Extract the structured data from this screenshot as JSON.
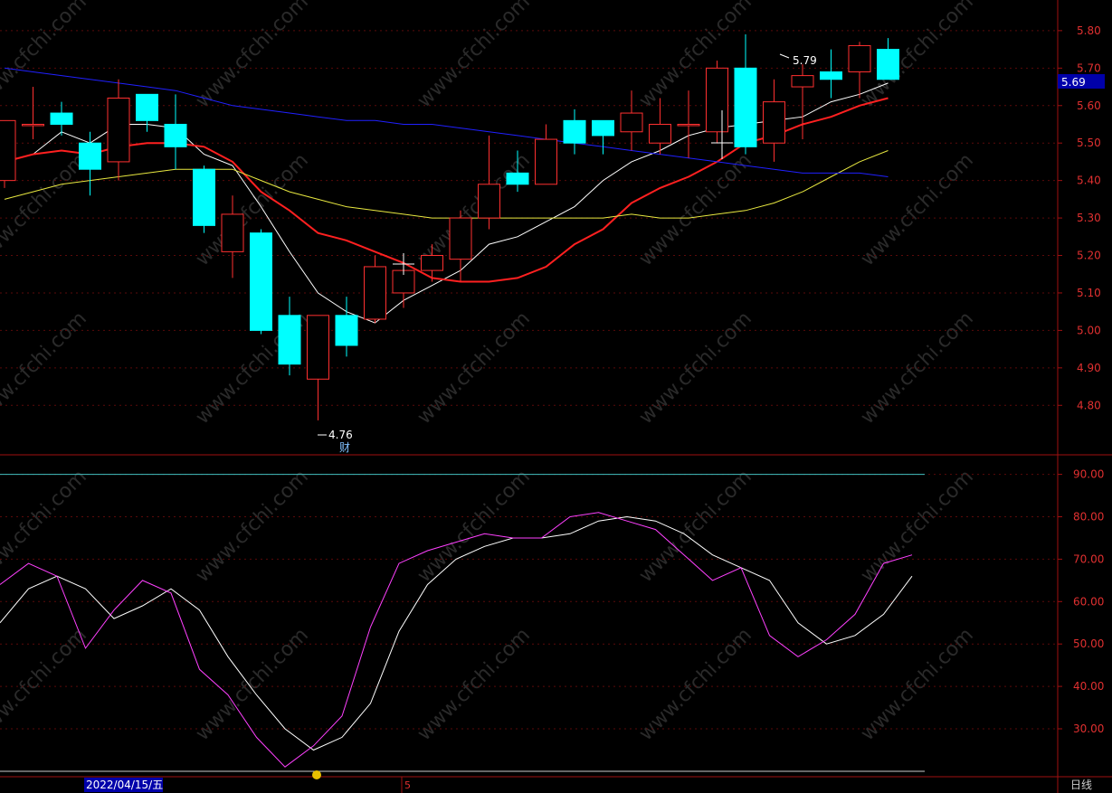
{
  "chart_data": [
    {
      "type": "candlestick",
      "period_label": "日线",
      "date_label": "2022/04/15/五",
      "axis_marker": "5",
      "ylim": [
        4.7,
        5.9
      ],
      "yticks": [
        "5.80",
        "5.70",
        "5.60",
        "5.50",
        "5.40",
        "5.30",
        "5.20",
        "5.10",
        "5.00",
        "4.90",
        "4.80"
      ],
      "current_price": "5.69",
      "high_label": "5.79",
      "low_label": "4.76",
      "event_marker": "财",
      "watermark": "www.cfchi.com",
      "colors": {
        "up": "#ff3030",
        "down": "#00ffff",
        "ma5": "#ffffff",
        "ma10": "#ff2020",
        "ma20": "#e8e840",
        "ma60": "#2020ff",
        "price_tag_bg": "#0000aa"
      },
      "candles": [
        {
          "o": 5.4,
          "h": 5.56,
          "l": 5.38,
          "c": 5.56
        },
        {
          "o": 5.55,
          "h": 5.65,
          "l": 5.51,
          "c": 5.55
        },
        {
          "o": 5.58,
          "h": 5.61,
          "l": 5.52,
          "c": 5.55
        },
        {
          "o": 5.5,
          "h": 5.53,
          "l": 5.36,
          "c": 5.43
        },
        {
          "o": 5.45,
          "h": 5.67,
          "l": 5.4,
          "c": 5.62
        },
        {
          "o": 5.63,
          "h": 5.63,
          "l": 5.53,
          "c": 5.56
        },
        {
          "o": 5.55,
          "h": 5.63,
          "l": 5.43,
          "c": 5.49
        },
        {
          "o": 5.43,
          "h": 5.44,
          "l": 5.26,
          "c": 5.28
        },
        {
          "o": 5.21,
          "h": 5.36,
          "l": 5.14,
          "c": 5.31
        },
        {
          "o": 5.26,
          "h": 5.27,
          "l": 4.99,
          "c": 5.0
        },
        {
          "o": 5.04,
          "h": 5.09,
          "l": 4.88,
          "c": 4.91
        },
        {
          "o": 4.87,
          "h": 5.04,
          "l": 4.76,
          "c": 5.04
        },
        {
          "o": 5.04,
          "h": 5.09,
          "l": 4.93,
          "c": 4.96
        },
        {
          "o": 5.03,
          "h": 5.2,
          "l": 5.02,
          "c": 5.17
        },
        {
          "o": 5.1,
          "h": 5.19,
          "l": 5.06,
          "c": 5.16
        },
        {
          "o": 5.16,
          "h": 5.23,
          "l": 5.13,
          "c": 5.2
        },
        {
          "o": 5.19,
          "h": 5.32,
          "l": 5.13,
          "c": 5.3
        },
        {
          "o": 5.3,
          "h": 5.52,
          "l": 5.27,
          "c": 5.39
        },
        {
          "o": 5.42,
          "h": 5.48,
          "l": 5.37,
          "c": 5.39
        },
        {
          "o": 5.39,
          "h": 5.55,
          "l": 5.39,
          "c": 5.51
        },
        {
          "o": 5.56,
          "h": 5.59,
          "l": 5.47,
          "c": 5.5
        },
        {
          "o": 5.56,
          "h": 5.56,
          "l": 5.47,
          "c": 5.52
        },
        {
          "o": 5.53,
          "h": 5.64,
          "l": 5.48,
          "c": 5.58
        },
        {
          "o": 5.5,
          "h": 5.62,
          "l": 5.47,
          "c": 5.55
        },
        {
          "o": 5.55,
          "h": 5.64,
          "l": 5.46,
          "c": 5.55
        },
        {
          "o": 5.53,
          "h": 5.72,
          "l": 5.5,
          "c": 5.7
        },
        {
          "o": 5.7,
          "h": 5.79,
          "l": 5.47,
          "c": 5.49
        },
        {
          "o": 5.5,
          "h": 5.67,
          "l": 5.45,
          "c": 5.61
        },
        {
          "o": 5.65,
          "h": 5.71,
          "l": 5.51,
          "c": 5.68
        },
        {
          "o": 5.69,
          "h": 5.75,
          "l": 5.62,
          "c": 5.67
        },
        {
          "o": 5.69,
          "h": 5.77,
          "l": 5.62,
          "c": 5.76
        },
        {
          "o": 5.75,
          "h": 5.78,
          "l": 5.67,
          "c": 5.67
        }
      ],
      "ma_series": [
        {
          "key": "ma5",
          "values": [
            5.45,
            5.47,
            5.53,
            5.5,
            5.55,
            5.55,
            5.54,
            5.47,
            5.44,
            5.33,
            5.21,
            5.1,
            5.05,
            5.02,
            5.08,
            5.12,
            5.16,
            5.23,
            5.25,
            5.29,
            5.33,
            5.4,
            5.45,
            5.48,
            5.52,
            5.54,
            5.55,
            5.56,
            5.57,
            5.61,
            5.63,
            5.66
          ]
        },
        {
          "key": "ma10",
          "values": [
            5.45,
            5.47,
            5.48,
            5.47,
            5.49,
            5.5,
            5.5,
            5.49,
            5.45,
            5.37,
            5.32,
            5.26,
            5.24,
            5.21,
            5.18,
            5.14,
            5.13,
            5.13,
            5.14,
            5.17,
            5.23,
            5.27,
            5.34,
            5.38,
            5.41,
            5.45,
            5.5,
            5.52,
            5.55,
            5.57,
            5.6,
            5.62
          ]
        },
        {
          "key": "ma20",
          "values": [
            5.35,
            5.37,
            5.39,
            5.4,
            5.41,
            5.42,
            5.43,
            5.43,
            5.43,
            5.4,
            5.37,
            5.35,
            5.33,
            5.32,
            5.31,
            5.3,
            5.3,
            5.3,
            5.3,
            5.3,
            5.3,
            5.3,
            5.31,
            5.3,
            5.3,
            5.31,
            5.32,
            5.34,
            5.37,
            5.41,
            5.45,
            5.48
          ]
        },
        {
          "key": "ma60",
          "values": [
            5.7,
            5.69,
            5.68,
            5.67,
            5.66,
            5.65,
            5.64,
            5.62,
            5.6,
            5.59,
            5.58,
            5.57,
            5.56,
            5.56,
            5.55,
            5.55,
            5.54,
            5.53,
            5.52,
            5.51,
            5.5,
            5.49,
            5.48,
            5.47,
            5.46,
            5.45,
            5.44,
            5.43,
            5.42,
            5.42,
            5.42,
            5.41
          ]
        }
      ]
    },
    {
      "type": "line",
      "ylim": [
        20,
        95
      ],
      "yticks": [
        "90.00",
        "80.00",
        "70.00",
        "60.00",
        "50.00",
        "40.00",
        "30.00"
      ],
      "reference_line": 90,
      "series": [
        {
          "key": "k",
          "color": "#ffffff",
          "values": [
            55,
            63,
            66,
            63,
            56,
            59,
            63,
            58,
            47,
            38,
            30,
            25,
            28,
            36,
            53,
            64,
            70,
            73,
            75,
            75,
            76,
            79,
            80,
            79,
            76,
            71,
            68,
            65,
            55,
            50,
            52,
            57,
            66
          ]
        },
        {
          "key": "d",
          "color": "#ff40ff",
          "values": [
            64,
            69,
            66,
            49,
            58,
            65,
            62,
            44,
            38,
            28,
            21,
            26,
            33,
            54,
            69,
            72,
            74,
            76,
            75,
            75,
            80,
            81,
            79,
            77,
            71,
            65,
            68,
            52,
            47,
            51,
            57,
            69,
            71
          ]
        }
      ]
    }
  ]
}
